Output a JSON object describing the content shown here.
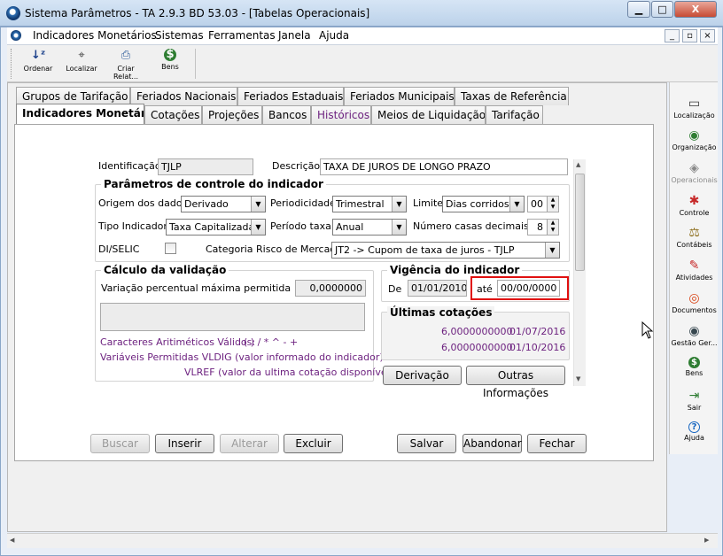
{
  "window": {
    "title": "Sistema Parâmetros -  TA 2.9.3 BD 53.03 - [Tabelas Operacionais]",
    "minimize": "▁",
    "maximize": "□",
    "close": "X"
  },
  "menu": {
    "items": [
      "Indicadores Monetários",
      "Sistemas",
      "Ferramentas",
      "Janela",
      "Ajuda"
    ],
    "mdi": {
      "minimize": "_",
      "restore": "▫",
      "close": "×"
    }
  },
  "toolbar": {
    "buttons": [
      {
        "label": "Ordenar",
        "icon": "sort-az-icon",
        "glyph": "↓ᶻ"
      },
      {
        "label": "Localizar",
        "icon": "locate-icon",
        "glyph": "⌖"
      },
      {
        "label": "Criar Relat...",
        "icon": "printer-icon",
        "glyph": "⎙"
      },
      {
        "label": "Bens",
        "icon": "money-bag-icon",
        "glyph": "$"
      }
    ]
  },
  "right_panel": {
    "items": [
      {
        "label": "Localização",
        "icon": "location-icon",
        "glyph": "▭",
        "color": "#333333",
        "enabled": true
      },
      {
        "label": "Organização",
        "icon": "organization-icon",
        "glyph": "◉",
        "color": "#2e7d32",
        "enabled": true
      },
      {
        "label": "Operacionais",
        "icon": "operations-icon",
        "glyph": "◈",
        "color": "#888888",
        "enabled": false
      },
      {
        "label": "Controle",
        "icon": "control-icon",
        "glyph": "✱",
        "color": "#c62828",
        "enabled": true
      },
      {
        "label": "Contábeis",
        "icon": "scales-icon",
        "glyph": "⚖",
        "color": "#8d6e1c",
        "enabled": true
      },
      {
        "label": "Atividades",
        "icon": "activities-icon",
        "glyph": "✎",
        "color": "#c62828",
        "enabled": true
      },
      {
        "label": "Documentos",
        "icon": "documents-icon",
        "glyph": "◎",
        "color": "#d84315",
        "enabled": true
      },
      {
        "label": "Gestão Ger...",
        "icon": "eye-icon",
        "glyph": "◉",
        "color": "#37474f",
        "enabled": true
      },
      {
        "label": "Bens",
        "icon": "money-bag-icon",
        "glyph": "$",
        "color": "#2e7d32",
        "enabled": true
      },
      {
        "label": "Sair",
        "icon": "exit-icon",
        "glyph": "⇥",
        "color": "#2e7d32",
        "enabled": true
      },
      {
        "label": "Ajuda",
        "icon": "help-icon",
        "glyph": "?",
        "color": "#1565c0",
        "enabled": true
      }
    ]
  },
  "tabs": {
    "row1": [
      "Grupos de Tarifação",
      "Feriados Nacionais",
      "Feriados Estaduais",
      "Feriados Municipais",
      "Taxas de Referência"
    ],
    "row2": [
      "Indicadores Monetários",
      "Cotações",
      "Projeções",
      "Bancos",
      "Históricos",
      "Meios de Liquidação",
      "Tarifação"
    ],
    "active": "Indicadores Monetários"
  },
  "form": {
    "identificacao_label": "Identificação",
    "identificacao_value": "TJLP",
    "descricao_label": "Descrição",
    "descricao_value": "TAXA DE JUROS DE LONGO PRAZO",
    "params_title": "Parâmetros de controle do indicador",
    "origem_label": "Origem dos dados",
    "origem_value": "Derivado",
    "periodicidade_label": "Periodicidade",
    "periodicidade_value": "Trimestral",
    "limite_label": "Limite",
    "limite_value": "Dias corridos",
    "limite_num": "00",
    "tipo_label": "Tipo Indicador",
    "tipo_value": "Taxa Capitalizada",
    "periodo_label": "Período taxa",
    "periodo_value": "Anual",
    "casas_label": "Número casas decimais",
    "casas_value": "8",
    "diselic_label": "DI/SELIC",
    "categoria_label": "Categoria Risco de Mercado",
    "categoria_value": "JT2 -> Cupom de taxa de juros - TJLP",
    "calc_title": "Cálculo da validação",
    "variacao_label": "Variação percentual máxima permitida",
    "variacao_value": "0,0000000",
    "caracteres_label": "Caracteres Aritiméticos Válidos:",
    "caracteres_value": "( ) / * ^ - +",
    "variaveis_label": "Variáveis Permitidas VLDIG  (valor informado do indicador)",
    "vlref_label": "VLREF  (valor da ultima cotação disponível)",
    "vigencia_title": "Vigência do indicador",
    "de_label": "De",
    "de_value": "01/01/2010",
    "ate_label": "até",
    "ate_value": "00/00/0000",
    "ultimas_title": "Últimas cotações",
    "cotacoes": [
      {
        "valor": "6,0000000000",
        "data": "01/07/2016"
      },
      {
        "valor": "6,0000000000",
        "data": "01/10/2016"
      }
    ],
    "derivacao_button": "Derivação",
    "outras_button": "Outras Informações"
  },
  "actions": {
    "buscar": "Buscar",
    "inserir": "Inserir",
    "alterar": "Alterar",
    "excluir": "Excluir",
    "salvar": "Salvar",
    "abandonar": "Abandonar",
    "fechar": "Fechar"
  },
  "colors": {
    "purple_text": "#6b1f7e",
    "highlight_box": "#e01010",
    "window_frame": "#bcd2ea"
  }
}
